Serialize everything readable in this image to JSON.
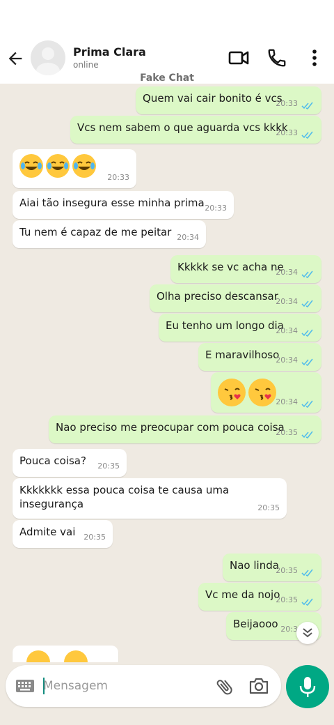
{
  "header": {
    "contact_name": "Prima Clara",
    "status": "online",
    "watermark": "Fake Chat"
  },
  "messages": [
    {
      "dir": "out",
      "text": "Quem vai cair bonito é vcs",
      "time": "20:33"
    },
    {
      "dir": "out",
      "text": "Vcs nem sabem o que aguarda vcs kkkk",
      "time": "20:33"
    },
    {
      "dir": "in",
      "emoji": "😂😂😂",
      "time": "20:33"
    },
    {
      "dir": "in",
      "text": "Aiai tão insegura esse minha prima",
      "time": "20:33"
    },
    {
      "dir": "in",
      "text": "Tu nem é capaz de me peitar",
      "time": "20:34"
    },
    {
      "dir": "out",
      "text": "Kkkkk se vc acha ne",
      "time": "20:34"
    },
    {
      "dir": "out",
      "text": "Olha preciso descansar",
      "time": "20:34"
    },
    {
      "dir": "out",
      "text": "Eu tenho um longo dia",
      "time": "20:34"
    },
    {
      "dir": "out",
      "text": "E maravilhoso",
      "time": "20:34"
    },
    {
      "dir": "out",
      "emoji": "😘😘",
      "time": "20:34"
    },
    {
      "dir": "out",
      "text": "Nao preciso me preocupar com pouca coisa",
      "time": "20:35"
    },
    {
      "dir": "in",
      "text": "Pouca coisa?",
      "time": "20:35"
    },
    {
      "dir": "in",
      "text": "Kkkkkkk essa pouca coisa te causa uma insegurança",
      "time": "20:35"
    },
    {
      "dir": "in",
      "text": "Admite vai",
      "time": "20:35"
    },
    {
      "dir": "out",
      "text": "Nao linda",
      "time": "20:35"
    },
    {
      "dir": "out",
      "text": "Vc me da nojo",
      "time": "20:35"
    },
    {
      "dir": "out",
      "text": "Beijaooo",
      "time": "20:3"
    }
  ],
  "composer": {
    "placeholder": "Mensagem"
  },
  "colors": {
    "outgoing_bubble": "#dcf8c6",
    "incoming_bubble": "#ffffff",
    "chat_background": "#efeae2",
    "accent": "#00a884",
    "read_ticks": "#53bdeb"
  },
  "icons": [
    "back-arrow-icon",
    "video-call-icon",
    "phone-icon",
    "more-options-icon",
    "keyboard-icon",
    "attach-icon",
    "camera-icon",
    "mic-icon",
    "scroll-down-icon"
  ]
}
